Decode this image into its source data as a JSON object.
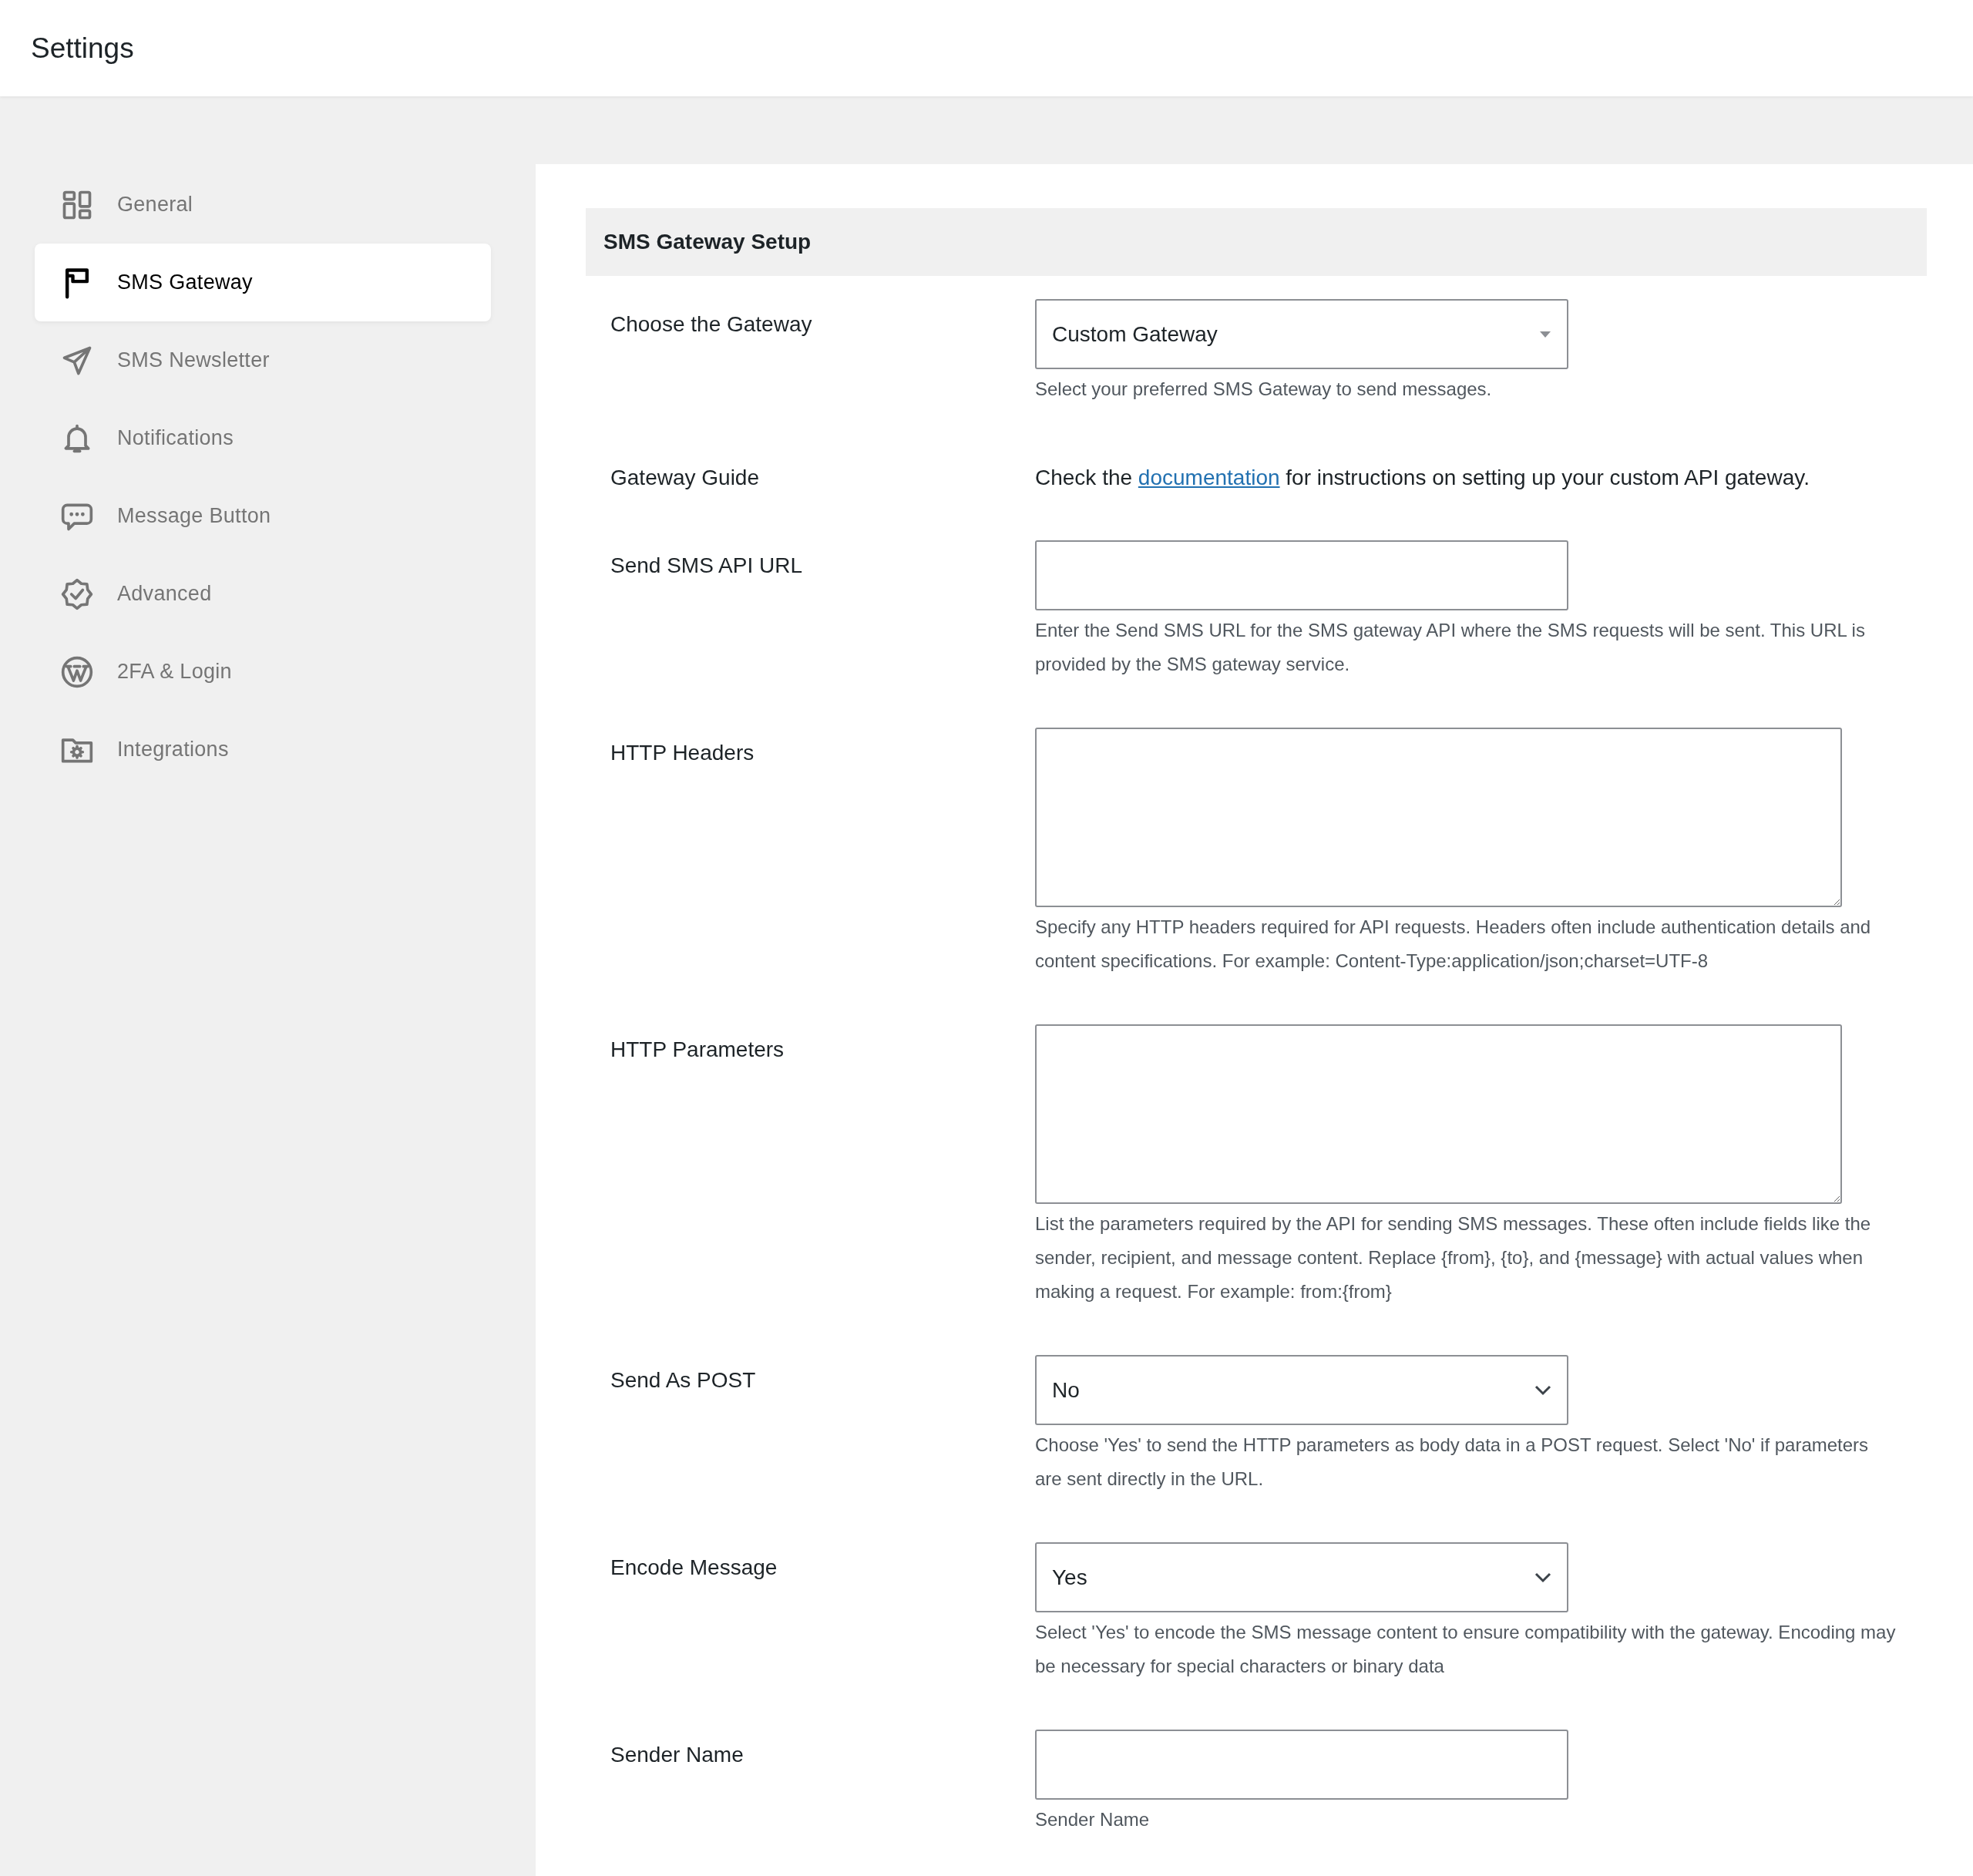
{
  "header": {
    "title": "Settings"
  },
  "sidebar": {
    "items": [
      {
        "label": "General",
        "selected": false
      },
      {
        "label": "SMS Gateway",
        "selected": true
      },
      {
        "label": "SMS Newsletter",
        "selected": false
      },
      {
        "label": "Notifications",
        "selected": false
      },
      {
        "label": "Message Button",
        "selected": false
      },
      {
        "label": "Advanced",
        "selected": false
      },
      {
        "label": "2FA & Login",
        "selected": false
      },
      {
        "label": "Integrations",
        "selected": false
      }
    ]
  },
  "section": {
    "title": "SMS Gateway Setup",
    "fields": [
      {
        "kind": "combo",
        "label": "Choose the Gateway",
        "value": "Custom Gateway",
        "help": "Select your preferred SMS Gateway to send messages."
      },
      {
        "kind": "guide",
        "label": "Gateway Guide",
        "before": "Check the",
        "link": "documentation",
        "after": "for instructions on setting up your custom API gateway."
      },
      {
        "kind": "input",
        "label": "Send SMS API URL",
        "help": "Enter the Send SMS URL for the SMS gateway API where the SMS requests will be sent. This URL is provided by the SMS gateway service."
      },
      {
        "kind": "textarea",
        "label": "HTTP Headers",
        "help": "Specify any HTTP headers required for API requests. Headers often include authentication details and content specifications. For example: Content-Type:application/json;charset=UTF-8"
      },
      {
        "kind": "textarea",
        "label": "HTTP Parameters",
        "help": "List the parameters required by the API for sending SMS messages. These often include fields like the sender, recipient, and message content. Replace {from}, {to}, and {message} with actual values when making a request. For example: from:{from}"
      },
      {
        "kind": "select",
        "label": "Send As POST",
        "value": "No",
        "help": "Choose 'Yes' to send the HTTP parameters as body data in a POST request. Select 'No' if parameters are sent directly in the URL."
      },
      {
        "kind": "select",
        "label": "Encode Message",
        "value": "Yes",
        "help": "Select 'Yes' to encode the SMS message content to ensure compatibility with the gateway. Encoding may be necessary for special characters or binary data"
      },
      {
        "kind": "input",
        "label": "Sender Name",
        "help": "Sender Name"
      }
    ]
  }
}
